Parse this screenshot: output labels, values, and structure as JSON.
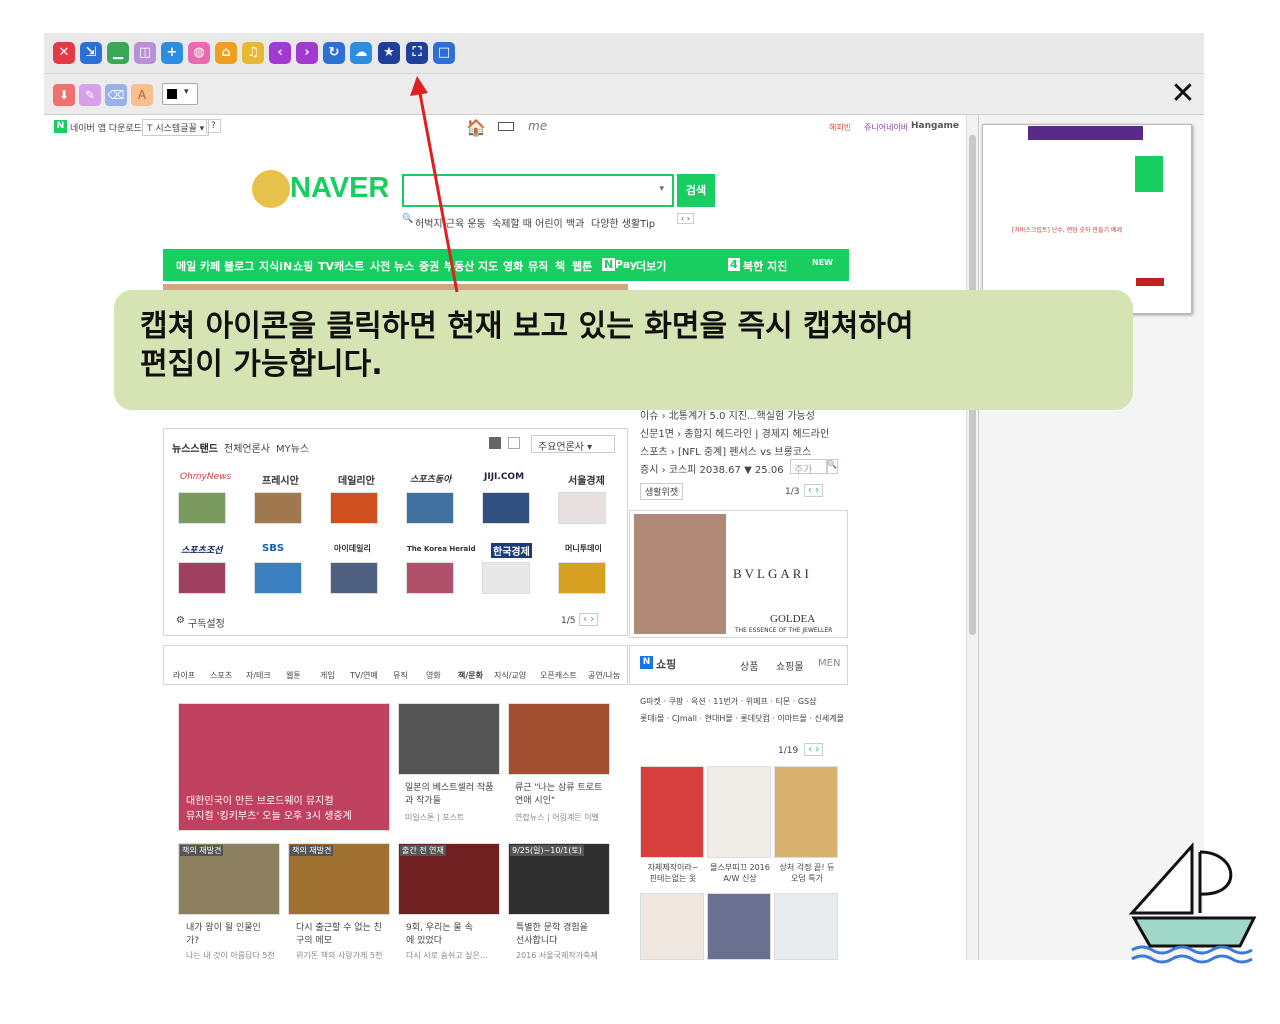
{
  "toolbar": {
    "icons": [
      "close-red",
      "minimize-window",
      "dash",
      "split-view",
      "add",
      "globe",
      "home",
      "music",
      "back",
      "forward",
      "refresh",
      "weather",
      "bookmark-star",
      "capture",
      "square"
    ]
  },
  "toolbar2": {
    "icons": [
      "save",
      "edit",
      "eraser",
      "text-font",
      "color-picker"
    ]
  },
  "naver": {
    "app_download": "네이버 앱 다운로드",
    "font_select": "T 시스템글꼴",
    "question": "?",
    "top_links": [
      "해피빈",
      "쥬니어네이버",
      "Hangame"
    ],
    "logo": "NAVER",
    "search_button": "검색",
    "keywords": [
      "허벅지 근육 운동",
      "숙제할 때 어린이 백과",
      "다양한 생활Tip"
    ],
    "nav": [
      "메일",
      "카페",
      "블로그",
      "지식iN",
      "쇼핑",
      "TV캐스트",
      "사전",
      "뉴스",
      "증권",
      "부동산",
      "지도",
      "영화",
      "뮤직",
      "책",
      "웹툰"
    ],
    "npay": "Pay",
    "more": "더보기",
    "north_label": "4",
    "north": "북한 지진",
    "new": "NEW",
    "newsstand": {
      "title": "뉴스스탠드",
      "all": "전체언론사",
      "my": "MY뉴스",
      "major": "주요언론사",
      "papers": [
        "OhmyNews",
        "프레시안",
        "데일리안",
        "스포츠동아",
        "JIJI.COM",
        "서울경제",
        "스포츠조선",
        "SBS",
        "아이데일리",
        "The Korea Herald",
        "한국경제",
        "머니투데이"
      ],
      "subscribe": "구독설정",
      "page": "1/5"
    },
    "news_right": [
      "이슈 › 北통계가 5.0 지진...핵실험 가능성",
      "신문1면 › 종합지 헤드라인 | 경제지 헤드라인",
      "스포츠 › [NFL 중계] 펜서스 vs 브롱코스",
      "증시 › 코스피 2038.67 ▼ 25.06"
    ],
    "stock_note": "주가",
    "life_btn": "생활위젯",
    "life_page": "1/3",
    "ad": {
      "brand": "BVLGARI",
      "sub": "GOLDEA",
      "tag": "THE ESSENCE OF THE JEWELLER"
    },
    "categories": [
      "라이프",
      "스포츠",
      "자/테크",
      "웹툰",
      "게임",
      "TV/연예",
      "뮤직",
      "영화",
      "책/문화",
      "지식/교양",
      "오픈캐스트",
      "공연/나눔"
    ],
    "contents": [
      {
        "text": "대한민국이 만든 브로드웨이 뮤지컬\n뮤지컬 '킹키부츠' 오늘 오후 3시 생중계"
      },
      {
        "text": "일본의 베스트셀러 작품과 작가들",
        "meta": "미일스톤 | 포스트"
      },
      {
        "text": "류근 \"나는 삼류 트로트 연애 시인\"",
        "meta": "연합뉴스 | 어링계든 이벨"
      },
      {
        "badge": "책의 재발견",
        "text": "내가 왕이 될 인물인가?",
        "meta": "나는 내 것이 아름답다 5천"
      },
      {
        "badge": "책의 재발견",
        "text": "다시 출근할 수 없는 친구의 메모",
        "meta": "위기돈 책의 사랑가게 5천"
      },
      {
        "badge": "출간 전 연재",
        "text": "9회, 우리는 물 속에 있었다",
        "meta": "다시 시로 숨쉬고 싶은..."
      },
      {
        "badge": "9/25(일)~10/1(토)",
        "text": "특별한 문학 경험을 선사합니다",
        "meta": "2016 서울국제작가축제"
      }
    ],
    "shopping": {
      "title": "쇼핑",
      "tabs": [
        "상품",
        "쇼핑몰",
        "MEN"
      ],
      "links1": "G마켓 · 쿠팡 · 옥션 · 11번가 · 위메프 · 티몬 · GS샵",
      "links2": "롯데i몰 · CJmall · 현대H몰 · 롯데닷컴 · 이마트몰 · 신세계몰",
      "page": "1/19",
      "items": [
        "자체제작이라~ 핀테는없는 옷",
        "몰스부띠끄 2016 A/W 신상",
        "상처 걱정 끝! 듀오덤 특가"
      ]
    }
  },
  "tooltip": {
    "text": "캡쳐 아이콘을 클릭하면 현재 보고 있는 화면을 즉시 캡쳐하여\n편집이 가능합니다."
  },
  "thumbnail": {
    "article": "[자바스크립트] 난수, 랜덤 숫자 만들기 예제"
  }
}
